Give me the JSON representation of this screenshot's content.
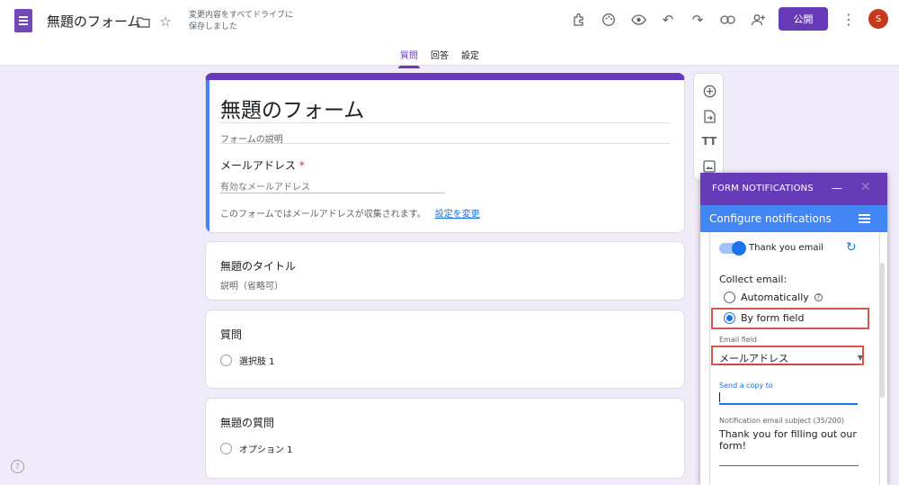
{
  "header": {
    "doc_title": "無題のフォーム",
    "save_status": "変更内容をすべてドライブに保存しました",
    "publish_label": "公開",
    "avatar_letter": "S"
  },
  "tabs": [
    {
      "label": "質問",
      "active": true
    },
    {
      "label": "回答",
      "active": false
    },
    {
      "label": "設定",
      "active": false
    }
  ],
  "form": {
    "title": "無題のフォーム",
    "description_placeholder": "フォームの説明",
    "email_label": "メールアドレス",
    "required_mark": "*",
    "email_placeholder": "有効なメールアドレス",
    "collect_note": "このフォームではメールアドレスが収集されます。",
    "change_settings_link": "設定を変更"
  },
  "questions": [
    {
      "title": "無題のタイトル",
      "subtitle": "説明（省略可）"
    },
    {
      "title": "質問",
      "option": "選択肢 1"
    },
    {
      "title": "無題の質問",
      "option": "オプション 1"
    }
  ],
  "panel": {
    "top_title": "FORM NOTIFICATIONS",
    "config_title": "Configure notifications",
    "thank_you_label": "Thank you email",
    "collect_email_label": "Collect email:",
    "option_auto": "Automatically",
    "option_form_field": "By form field",
    "email_field_label": "Email field",
    "email_field_value": "メールアドレス",
    "send_copy_label": "Send a copy to",
    "subject_label": "Notification email subject (35/200)",
    "subject_value": "Thank you for filling out our form!"
  },
  "colors": {
    "brand": "#673ab7",
    "accent": "#4285f4",
    "highlight": "#d9534f",
    "background": "#f0ebf8"
  }
}
